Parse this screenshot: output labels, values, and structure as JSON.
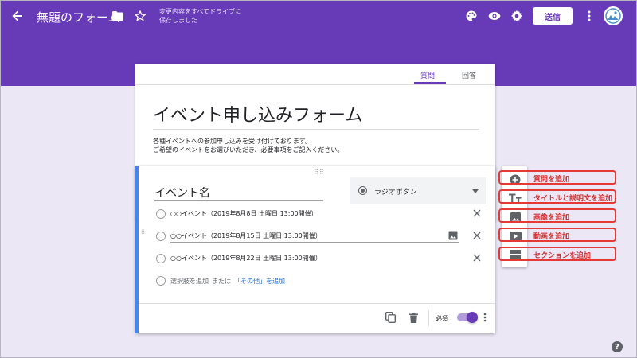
{
  "header": {
    "form_title": "無題のフォーム",
    "save_status_line1": "変更内容をすべてドライブに",
    "save_status_line2": "保存しました",
    "send_label": "送信",
    "accent_color": "#673ab7"
  },
  "tabs": [
    {
      "label": "質問",
      "active": true
    },
    {
      "label": "回答",
      "active": false
    }
  ],
  "form": {
    "title": "イベント申し込みフォーム",
    "description_line1": "各種イベントへの参加申し込みを受け付けております。",
    "description_line2": "ご希望のイベントをお選びいただき、必要事項をご記入ください。"
  },
  "question": {
    "title": "イベント名",
    "type_label": "ラジオボタン",
    "options": [
      {
        "text": "○○イベント（2019年8月8日 土曜日 13:00開催）"
      },
      {
        "text": "○○イベント（2019年8月15日 土曜日 13:00開催）"
      },
      {
        "text": "○○イベント（2019年8月22日 土曜日 13:00開催）"
      }
    ],
    "add_option_text": "選択肢を追加",
    "or_text": "または",
    "add_other_text": "「その他」を追加",
    "required_label": "必須",
    "required": true
  },
  "side_toolbar": {
    "callouts": [
      {
        "label": "質問を追加",
        "icon": "add-circle-icon"
      },
      {
        "label": "タイトルと説明文を追加",
        "icon": "title-text-icon"
      },
      {
        "label": "画像を追加",
        "icon": "image-icon"
      },
      {
        "label": "動画を追加",
        "icon": "video-icon"
      },
      {
        "label": "セクションを追加",
        "icon": "section-icon"
      }
    ],
    "callout_color": "#e53935"
  },
  "help": {
    "label": "?"
  }
}
